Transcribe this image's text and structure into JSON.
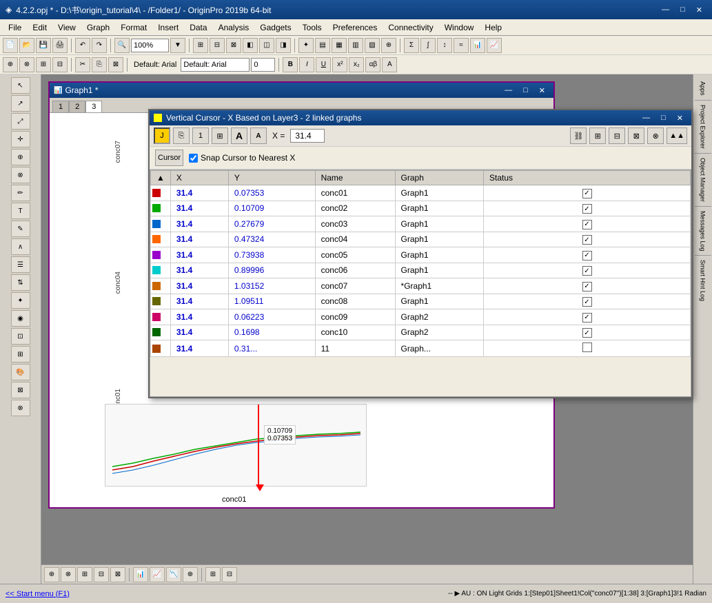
{
  "titlebar": {
    "title": "4.2.2.opj * - D:\\书\\origin_tutorial\\4\\ - /Folder1/ - OriginPro 2019b 64-bit",
    "icon": "◈",
    "min": "—",
    "max": "□",
    "close": "✕"
  },
  "menubar": {
    "items": [
      "File",
      "Edit",
      "View",
      "Graph",
      "Format",
      "Insert",
      "Data",
      "Analysis",
      "Gadgets",
      "Tools",
      "Preferences",
      "Connectivity",
      "Window",
      "Help"
    ]
  },
  "graph_window": {
    "title": "Graph1 *",
    "tabs": [
      "1",
      "2",
      "3"
    ],
    "active_tab": 2
  },
  "vc_dialog": {
    "title": "Vertical Cursor - X Based on Layer3 - 2 linked graphs",
    "x_label": "X =",
    "x_value": "31.4",
    "snap_label": "Snap Cursor to Nearest X",
    "cursor_tab": "Cursor",
    "columns": [
      "X",
      "Y",
      "Name",
      "Graph",
      "Status"
    ],
    "rows": [
      {
        "x": "31.4",
        "y": "0.07353",
        "name": "conc01",
        "graph": "Graph1",
        "checked": true
      },
      {
        "x": "31.4",
        "y": "0.10709",
        "name": "conc02",
        "graph": "Graph1",
        "checked": true
      },
      {
        "x": "31.4",
        "y": "0.27679",
        "name": "conc03",
        "graph": "Graph1",
        "checked": true
      },
      {
        "x": "31.4",
        "y": "0.47324",
        "name": "conc04",
        "graph": "Graph1",
        "checked": true
      },
      {
        "x": "31.4",
        "y": "0.73938",
        "name": "conc05",
        "graph": "Graph1",
        "checked": true
      },
      {
        "x": "31.4",
        "y": "0.89996",
        "name": "conc06",
        "graph": "Graph1",
        "checked": true
      },
      {
        "x": "31.4",
        "y": "1.03152",
        "name": "conc07",
        "graph": "*Graph1",
        "checked": true
      },
      {
        "x": "31.4",
        "y": "1.09511",
        "name": "conc08",
        "graph": "Graph1",
        "checked": true
      },
      {
        "x": "31.4",
        "y": "0.06223",
        "name": "conc09",
        "graph": "Graph2",
        "checked": true
      },
      {
        "x": "31.4",
        "y": "0.1698",
        "name": "conc10",
        "graph": "Graph2",
        "checked": true
      }
    ],
    "partial_row": {
      "x": "31.4",
      "y": "0.31...",
      "name": "11",
      "graph": "Graph..."
    }
  },
  "status_bar": {
    "left": "<< Start menu (F1)",
    "right": "-- ▶ AU : ON  Light Grids  1:[Step01]Sheet1!Col(\"conc07\")[1:38]  3:[Graph1]3!1  Radian"
  },
  "axis_labels": {
    "conc07": "conc07",
    "conc04": "conc04",
    "conc01": "conc01"
  },
  "chart": {
    "cursor_x": "conc01",
    "tooltip1": "0.10709",
    "tooltip2": "0.07353"
  },
  "colors": {
    "titlebar_bg": "#1a5296",
    "accent": "#800080",
    "link_blue": "#0000cc"
  }
}
